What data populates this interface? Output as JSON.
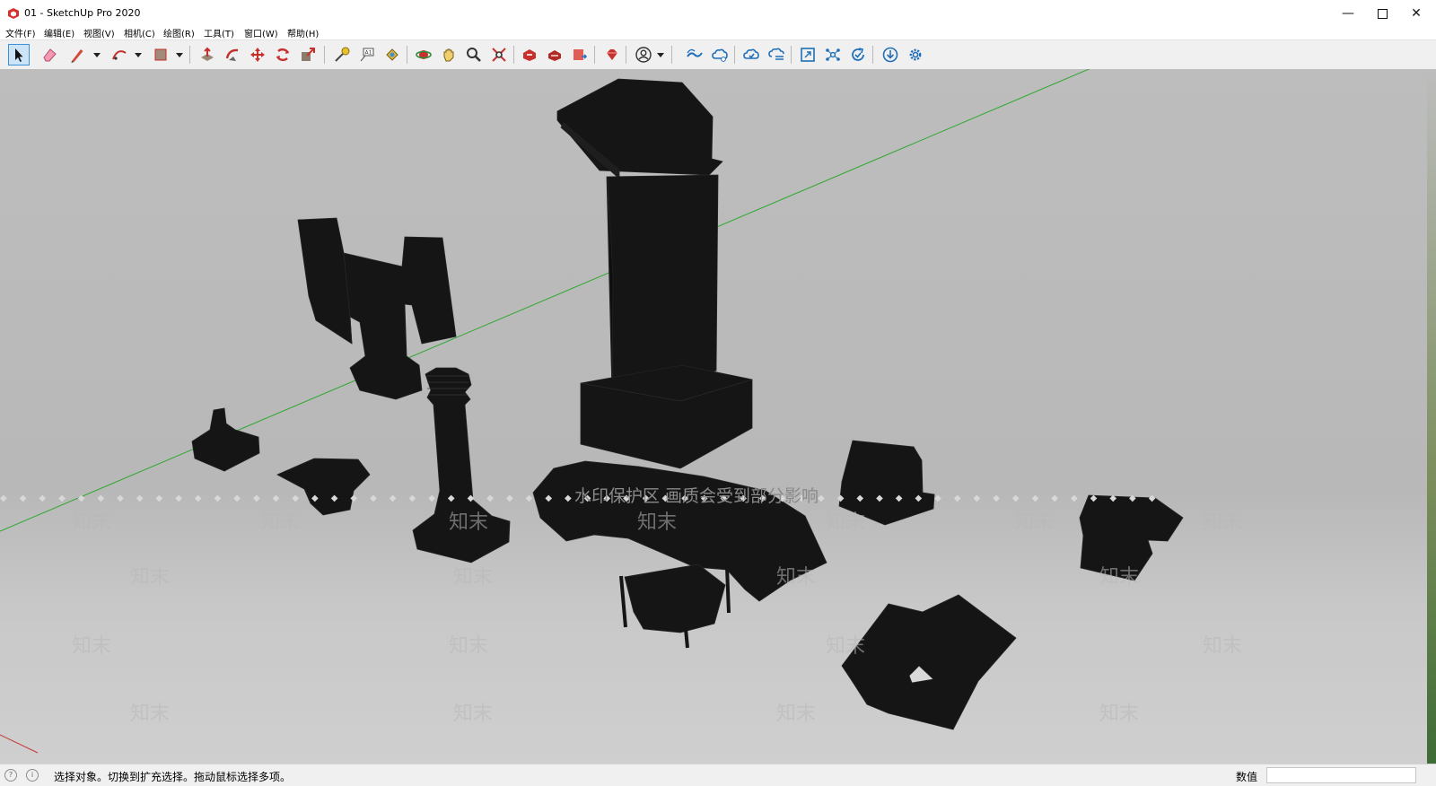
{
  "window": {
    "title": "01 - SketchUp Pro 2020",
    "controls": [
      "minimize-icon",
      "maximize-icon",
      "close-icon"
    ]
  },
  "menu": {
    "items": [
      {
        "label": "文件(F)"
      },
      {
        "label": "编辑(E)"
      },
      {
        "label": "视图(V)"
      },
      {
        "label": "相机(C)"
      },
      {
        "label": "绘图(R)"
      },
      {
        "label": "工具(T)"
      },
      {
        "label": "窗口(W)"
      },
      {
        "label": "帮助(H)"
      }
    ]
  },
  "toolbar": {
    "tools": [
      {
        "icon": "select-arrow-icon",
        "active": true
      },
      {
        "icon": "eraser-icon"
      },
      {
        "icon": "pencil-line-icon"
      },
      {
        "icon": "arc-icon"
      },
      {
        "icon": "rectangle-icon"
      },
      {
        "icon": "push-pull-icon"
      },
      {
        "icon": "follow-me-icon"
      },
      {
        "icon": "move-icon"
      },
      {
        "icon": "rotate-icon"
      },
      {
        "icon": "scale-icon"
      },
      {
        "icon": "tape-measure-icon"
      },
      {
        "icon": "text-label-icon"
      },
      {
        "icon": "paint-bucket-icon"
      },
      {
        "icon": "orbit-icon"
      },
      {
        "icon": "pan-icon"
      },
      {
        "icon": "zoom-icon"
      },
      {
        "icon": "zoom-extents-icon"
      },
      {
        "icon": "warehouse-icon"
      },
      {
        "icon": "extension-warehouse-icon"
      },
      {
        "icon": "layout-send-icon"
      },
      {
        "icon": "ruby-extension-icon"
      },
      {
        "icon": "account-icon"
      },
      {
        "icon": "trimble-connect-icon"
      },
      {
        "icon": "cloud-sync-icon"
      },
      {
        "icon": "cloud-upload-icon"
      },
      {
        "icon": "cloud-list-icon"
      },
      {
        "icon": "resize-window-icon"
      },
      {
        "icon": "network-icon"
      },
      {
        "icon": "refresh-check-icon"
      },
      {
        "icon": "download-icon"
      },
      {
        "icon": "settings-gear-icon"
      }
    ]
  },
  "viewport": {
    "watermark_text": "水印保护区   画质会受到部分影响",
    "watermark_mark": "知末",
    "background_color": "#bcbcbc",
    "axis_color": "#2fa82f",
    "model_color": "#141414"
  },
  "status": {
    "message": "选择对象。切换到扩充选择。拖动鼠标选择多项。",
    "measurement_label": "数值",
    "measurement_value": ""
  }
}
